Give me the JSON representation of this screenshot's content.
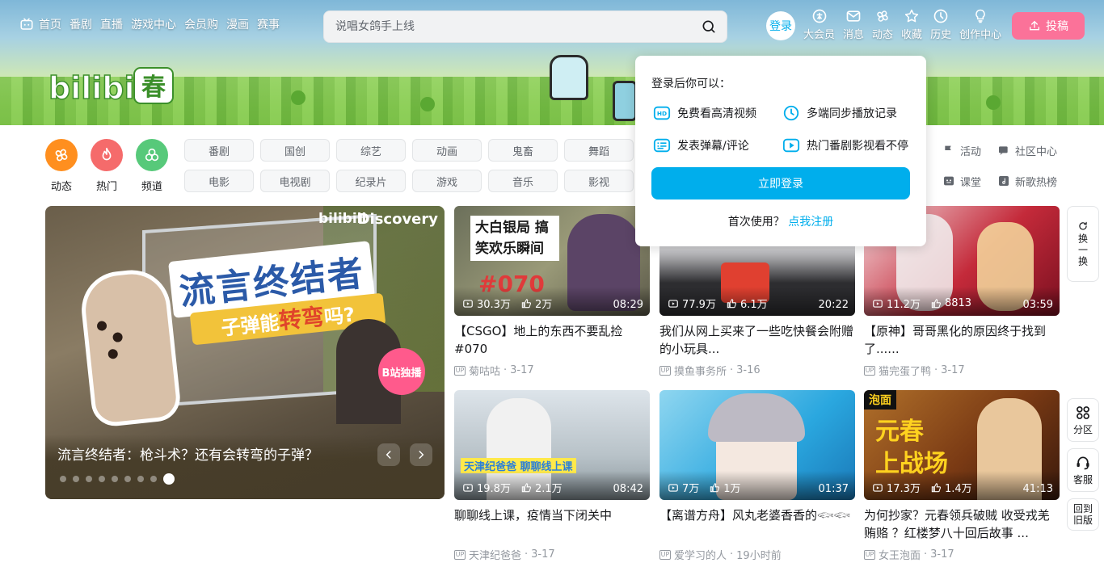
{
  "header": {
    "logo_text": "bilibili",
    "logo_badge": "春",
    "nav": [
      "首页",
      "番剧",
      "直播",
      "游戏中心",
      "会员购",
      "漫画",
      "赛事"
    ],
    "search_placeholder": "说唱女鸽手上线",
    "login": "登录",
    "right_nav": [
      {
        "label": "大会员",
        "icon": "vip-icon"
      },
      {
        "label": "消息",
        "icon": "message-icon"
      },
      {
        "label": "动态",
        "icon": "dynamic-icon"
      },
      {
        "label": "收藏",
        "icon": "favorite-icon"
      },
      {
        "label": "历史",
        "icon": "history-icon"
      },
      {
        "label": "创作中心",
        "icon": "creator-icon"
      }
    ],
    "upload": "投稿"
  },
  "channels": {
    "circles": [
      {
        "label": "动态",
        "color": "#ff8f1f"
      },
      {
        "label": "热门",
        "color": "#f56b6b"
      },
      {
        "label": "频道",
        "color": "#57c97a"
      }
    ],
    "tags": [
      "番剧",
      "国创",
      "综艺",
      "动画",
      "鬼畜",
      "舞蹈",
      "电影",
      "电视剧",
      "纪录片",
      "游戏",
      "音乐",
      "影视"
    ],
    "side_links": [
      {
        "label": "活动",
        "icon": "flag-icon"
      },
      {
        "label": "社区中心",
        "icon": "community-icon"
      },
      {
        "label": "课堂",
        "icon": "classroom-icon"
      },
      {
        "label": "新歌热榜",
        "icon": "music-chart-icon"
      }
    ]
  },
  "hero": {
    "caption": "流言终结者：枪斗术？还有会转弯的子弹？",
    "art_title": "流言终结者",
    "art_sub_a": "子弹能",
    "art_sub_b": "转弯",
    "art_sub_c": "吗?",
    "brand_a": "bilibili",
    "brand_b": "Discovery",
    "badge": "B站独播",
    "slides": 9,
    "active_slide": 9
  },
  "videos": [
    {
      "views": "30.3万",
      "likes": "2万",
      "duration": "08:29",
      "title": "【CSGO】地上的东西不要乱捡 #070",
      "up": "菊咕咕",
      "date": "3-17",
      "art_text": "大白银局 搞笑欢乐瞬间",
      "art_num": "#070"
    },
    {
      "views": "77.9万",
      "likes": "6.1万",
      "duration": "20:22",
      "title": "我们从网上买来了一些吃快餐会附赠的小玩具...",
      "up": "摸鱼事务所",
      "date": "3-16"
    },
    {
      "views": "11.2万",
      "likes": "8813",
      "duration": "03:59",
      "title": "【原神】哥哥黑化的原因终于找到了......",
      "up": "猫完蛋了鸭",
      "date": "3-17"
    },
    {
      "views": "19.8万",
      "likes": "2.1万",
      "duration": "08:42",
      "title": "聊聊线上课，疫情当下闭关中",
      "up": "天津纪爸爸",
      "date": "3-17",
      "art_text": "天津纪爸爸 聊聊线上课"
    },
    {
      "views": "7万",
      "likes": "1万",
      "duration": "01:37",
      "title": "【离谱方舟】风丸老婆香香的𓆟𓆟",
      "up": "爱学习的人",
      "date": "19小时前"
    },
    {
      "views": "17.3万",
      "likes": "1.4万",
      "duration": "41:13",
      "title": "为何抄家？元春领兵破贼 收受戎羌贿赂 ？红楼梦八十回后故事 ...",
      "up": "女王泡面",
      "date": "3-17",
      "art_text": "元春 上战场",
      "art_tag": "泡面"
    }
  ],
  "fabs": [
    {
      "label": "换一换",
      "icon": "refresh-icon"
    },
    {
      "label": "分区",
      "icon": "partition-icon"
    },
    {
      "label": "客服",
      "icon": "customer-service-icon"
    },
    {
      "label": "回到旧版",
      "icon": "old-version-icon"
    }
  ],
  "login_popup": {
    "title": "登录后你可以：",
    "perks": [
      {
        "label": "免费看高清视频",
        "icon": "hd-icon"
      },
      {
        "label": "多端同步播放记录",
        "icon": "clock-icon"
      },
      {
        "label": "发表弹幕/评论",
        "icon": "danmaku-icon"
      },
      {
        "label": "热门番剧影视看不停",
        "icon": "play-icon"
      }
    ],
    "button": "立即登录",
    "footer_prefix": "首次使用？",
    "footer_link": "点我注册"
  },
  "colors": {
    "accent": "#00aeec",
    "brand_pink": "#fb7299"
  }
}
